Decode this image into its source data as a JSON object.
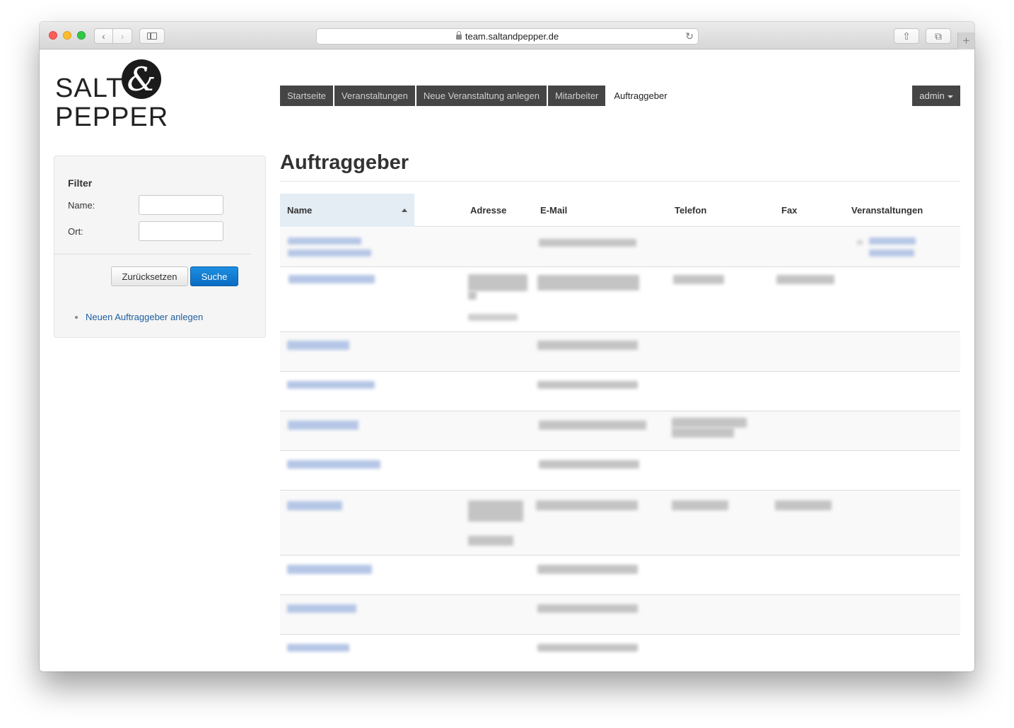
{
  "browser": {
    "url": "team.saltandpepper.de"
  },
  "logo": {
    "line1": "SALT",
    "line2": "PEPPER",
    "ampersand": "&"
  },
  "nav": {
    "items": [
      "Startseite",
      "Veranstaltungen",
      "Neue Veranstaltung anlegen",
      "Mitarbeiter",
      "Auftraggeber"
    ],
    "active": "Auftraggeber",
    "user_menu": "admin"
  },
  "filter": {
    "title": "Filter",
    "name_label": "Name:",
    "name_value": "",
    "ort_label": "Ort:",
    "ort_value": "",
    "reset_label": "Zurücksetzen",
    "search_label": "Suche",
    "new_client_link": "Neuen Auftraggeber anlegen"
  },
  "page_title": "Auftraggeber",
  "table": {
    "columns": [
      "Name",
      "Adresse",
      "E-Mail",
      "Telefon",
      "Fax",
      "Veranstaltungen"
    ],
    "sorted_column": "Name",
    "sort_direction": "ascending",
    "row_count_visible": 11,
    "content_note": "cell values are blurred/unreadable"
  },
  "colors": {
    "nav_bg": "#454545",
    "primary_button": "#0a6cc2",
    "link": "#1f5fa0",
    "sorted_header_bg": "#e4ecf4"
  }
}
